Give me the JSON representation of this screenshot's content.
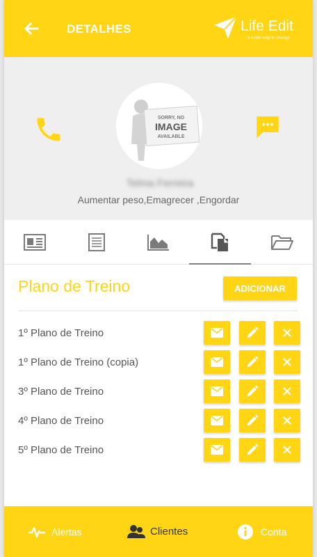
{
  "header": {
    "title": "DETALHES",
    "back_icon": "arrow-left-icon",
    "logo_text": "Life Edit",
    "logo_tagline": "a better way to change"
  },
  "profile": {
    "avatar_text": [
      "SORRY, NO",
      "IMAGE",
      "AVAILABLE"
    ],
    "name": "Telma Ferreira",
    "goals": "Aumentar peso,Emagrecer ,Engordar",
    "phone_icon": "phone-icon",
    "chat_icon": "chat-icon"
  },
  "tabs": [
    {
      "icon": "id-card-icon"
    },
    {
      "icon": "document-list-icon"
    },
    {
      "icon": "area-chart-icon"
    },
    {
      "icon": "copy-documents-icon",
      "active": true
    },
    {
      "icon": "folder-open-icon"
    }
  ],
  "section": {
    "title": "Plano de Treino",
    "add_label": "ADICIONAR"
  },
  "plans": [
    {
      "name": "1º Plano de Treino"
    },
    {
      "name": "1º Plano de Treino (copia)"
    },
    {
      "name": "3º Plano de Treino"
    },
    {
      "name": "4º Plano de Treino"
    },
    {
      "name": "5º Plano de Treino"
    }
  ],
  "bottom_nav": {
    "alerts": "Alertas",
    "clients": "Clientes",
    "account": "Conta"
  },
  "colors": {
    "accent": "#ffd514",
    "text": "#555555"
  }
}
